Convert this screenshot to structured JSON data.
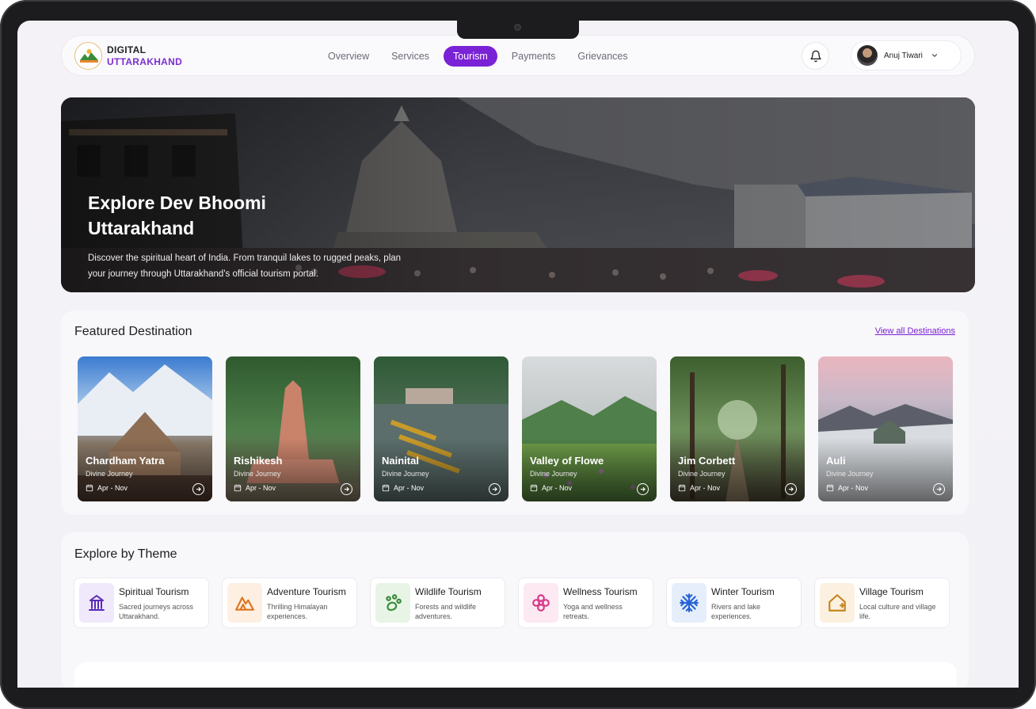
{
  "brand": {
    "line1": "DIGITAL",
    "line2": "UTTARAKHAND"
  },
  "nav": {
    "items": [
      {
        "label": "Overview",
        "active": false
      },
      {
        "label": "Services",
        "active": false
      },
      {
        "label": "Tourism",
        "active": true
      },
      {
        "label": "Payments",
        "active": false
      },
      {
        "label": "Grievances",
        "active": false
      }
    ]
  },
  "user": {
    "name": "Anuj Tiwari"
  },
  "hero": {
    "title": "Explore Dev Bhoomi Uttarakhand",
    "description": "Discover the spiritual heart of India. From tranquil lakes to rugged peaks, plan your journey through Uttarakhand's official tourism portal."
  },
  "featured": {
    "title": "Featured Destination",
    "view_all": "View all Destinations",
    "cards": [
      {
        "name": "Chardham Yatra",
        "sub": "Divine Journey",
        "date": "Apr - Nov"
      },
      {
        "name": "Rishikesh",
        "sub": "Divine Journey",
        "date": "Apr - Nov"
      },
      {
        "name": "Nainital",
        "sub": "Divine Journey",
        "date": "Apr - Nov"
      },
      {
        "name": "Valley of Flowe",
        "sub": "Divine Journey",
        "date": "Apr - Nov"
      },
      {
        "name": "Jim Corbett",
        "sub": "Divine Journey",
        "date": "Apr - Nov"
      },
      {
        "name": "Auli",
        "sub": "Divine Journey",
        "date": "Apr - Nov"
      }
    ]
  },
  "themes": {
    "title": "Explore by Theme",
    "items": [
      {
        "name": "Spiritual Tourism",
        "desc": "Sacred journeys across Uttarakhand.",
        "icon": "temple-icon",
        "color": "#5b2bb8",
        "bg": "#efe9fb"
      },
      {
        "name": "Adventure Tourism",
        "desc": "Thrilling Himalayan experiences.",
        "icon": "mountain-icon",
        "color": "#e0741d",
        "bg": "#fdf0e3"
      },
      {
        "name": "Wildlife Tourism",
        "desc": "Forests and wildlife adventures.",
        "icon": "paw-icon",
        "color": "#3a8c3a",
        "bg": "#e8f4e6"
      },
      {
        "name": "Wellness Tourism",
        "desc": "Yoga and wellness retreats.",
        "icon": "flower-icon",
        "color": "#d93a8a",
        "bg": "#fce9f2"
      },
      {
        "name": "Winter Tourism",
        "desc": "Rivers and lake experiences.",
        "icon": "snowflake-icon",
        "color": "#2563d9",
        "bg": "#e7eefb"
      },
      {
        "name": "Village Tourism",
        "desc": "Local culture and village life.",
        "icon": "home-plus-icon",
        "color": "#c7851d",
        "bg": "#fcf1e0"
      }
    ]
  }
}
